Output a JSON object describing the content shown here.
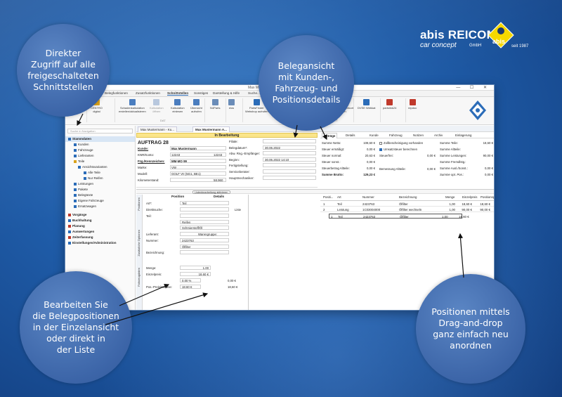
{
  "logo": {
    "brand": "abis REICOM",
    "tagline": "car concept",
    "gmbh": "GmbH",
    "since": "seit 1987",
    "abis": "abis"
  },
  "bubbles": {
    "b1": "Direkter\nZugriff auf alle\nfreigeschalteten\nSchnittstellen",
    "b2": "Belegansicht\nmit Kunden-,\nFahrzeug- und\nPositionsdetails",
    "b3": "Bearbeiten Sie\ndie Belegpositionen\nin der Einzelansicht\noder direkt in\nder Liste",
    "b4": "Positionen mittels\nDrag-and-drop\nganz einfach neu\nanordnen"
  },
  "window": {
    "title": "Max Mustermann - ...",
    "controls": "— ☐ ✕",
    "ribbon_tabs": [
      "Datei",
      "Belegfunktionen",
      "Zusatzfunktionen",
      "Schnittstellen",
      "Sonstiges",
      "Darstellung & Hilfe",
      "Suche..."
    ]
  },
  "ribbon": {
    "buttons": [
      {
        "label": "ATP Pilot",
        "color": "#2b6cb8"
      },
      {
        "label": "CENTRO\ndigital",
        "color": "#d9a21b"
      },
      {
        "label": "Schadenkalkulation\nerstellen/aktualisieren",
        "color": "#4a7dbf"
      },
      {
        "label": "Kalkulation\nöffnen",
        "color": "#b8c8de"
      },
      {
        "label": "Kalkulation\neinlesen",
        "color": "#4a7dbf"
      },
      {
        "label": "Übersicht\naufrufen",
        "color": "#4a7dbf"
      },
      {
        "label": "N4Parts",
        "color": "#6a8cb8"
      },
      {
        "label": "eios",
        "color": "#6a8cb8"
      },
      {
        "label": "PartsFinder\nWebshop aufrufen",
        "color": "#2b6cb8"
      },
      {
        "label": "PartsFinder Warenkorb\nimportieren",
        "color": "#2b6cb8"
      },
      {
        "label": "DVSE NEXT\naufrufen",
        "color": "#b8c8de"
      },
      {
        "label": "DVSE NEXT Warenkorb\nimportieren",
        "color": "#2b6cb8"
      },
      {
        "label": "DVSE Webkat",
        "color": "#2b6cb8"
      },
      {
        "label": "partslink24",
        "color": "#c0392b"
      },
      {
        "label": "repdoc",
        "color": "#c0392b"
      }
    ],
    "groups": [
      "DAT",
      "PartsFinder",
      "DVSE NEXT"
    ]
  },
  "sidebar": {
    "search_placeholder": "Suche in Navigation",
    "items": [
      {
        "label": "Stammdaten",
        "type": "h",
        "color": "#2b6cb8"
      },
      {
        "label": "Kunden",
        "type": "c",
        "color": "#2b6cb8"
      },
      {
        "label": "Fahrzeuge",
        "type": "c",
        "color": "#2b6cb8"
      },
      {
        "label": "Lieferanten",
        "type": "c",
        "color": "#2b6cb8"
      },
      {
        "label": "Teile",
        "type": "c",
        "color": "#d9a21b"
      },
      {
        "label": "Ansichtsvarianten",
        "type": "d",
        "color": "#2b6cb8"
      },
      {
        "label": "Alle Teile",
        "type": "e",
        "color": "#2b6cb8"
      },
      {
        "label": "Nur Reifen",
        "type": "e",
        "color": "#2b6cb8"
      },
      {
        "label": "Leistungen",
        "type": "c",
        "color": "#2b6cb8"
      },
      {
        "label": "Pakete",
        "type": "c",
        "color": "#2b6cb8"
      },
      {
        "label": "Belegtexte",
        "type": "c",
        "color": "#2b6cb8"
      },
      {
        "label": "Eigene Fahrzeuge",
        "type": "c",
        "color": "#2b6cb8"
      },
      {
        "label": "Ersatzwagen",
        "type": "c",
        "color": "#2b6cb8"
      },
      {
        "label": "Vorgänge",
        "type": "h",
        "color": "#c0392b"
      },
      {
        "label": "Buchhaltung",
        "type": "h",
        "color": "#2b6cb8"
      },
      {
        "label": "Planung",
        "type": "h",
        "color": "#c0392b"
      },
      {
        "label": "Auswertungen",
        "type": "h",
        "color": "#2b6cb8"
      },
      {
        "label": "Zeiterfassung",
        "type": "h",
        "color": "#c0392b"
      },
      {
        "label": "Einstellungen/Administration",
        "type": "h",
        "color": "#2b6cb8"
      }
    ]
  },
  "doc_tabs": [
    "Max Mustermann - Ku...",
    "Max Mustermann A..."
  ],
  "status": "In Bearbeitung",
  "form": {
    "title": "AUFTRAG 28",
    "left": [
      {
        "label": "Kunde:",
        "value": "Max Mustermann",
        "extra": ""
      },
      {
        "label": "KNR/Konto:",
        "value": "12243",
        "extra": "12243"
      },
      {
        "label": "Fzg./Kennzeichen:",
        "value": "MM-MO 99",
        "extra": ""
      },
      {
        "label": "Marke:",
        "value": "VW",
        "extra": ""
      },
      {
        "label": "Modell:",
        "value": "GOLF VII (5G1, BE1)",
        "extra": ""
      },
      {
        "label": "Kilometerstand:",
        "value": "",
        "extra": "58.960"
      }
    ],
    "right": [
      {
        "label": "Filiale:",
        "value": ""
      },
      {
        "label": "Belegdatum*:",
        "value": "30.06.2022"
      },
      {
        "label": "Abw. Rng.-Empfänger:",
        "value": ""
      },
      {
        "label": "Beginn:",
        "value": "30.06.2022 14:10"
      },
      {
        "label": "Fertigstellung:",
        "value": ""
      },
      {
        "label": "Serviceberater:",
        "value": ""
      },
      {
        "label": "Hauptmechaniker:",
        "value": ""
      }
    ]
  },
  "summary": {
    "tabs": [
      "Beträge",
      "Details",
      "Kunde",
      "Fahrzeug",
      "Notizen",
      "Archiv",
      "Einlagerung"
    ],
    "col1": [
      {
        "label": "Summe Netto:",
        "value": "108,60 €"
      },
      {
        "label": "Steuer ermäßigt:",
        "value": "0,00 €"
      },
      {
        "label": "Steuer normal:",
        "value": "20,63 €"
      },
      {
        "label": "Steuer sonst.:",
        "value": "0,00 €"
      },
      {
        "label": "Steuerbetrag Altteile:",
        "value": "0,00 €"
      },
      {
        "label": "Summe Brutto:",
        "value": "129,23 €"
      }
    ],
    "col2": [
      {
        "label": "Zollbescheinigung vorhanden",
        "value": "",
        "check": false
      },
      {
        "label": "Umsatzsteuer berechnen",
        "value": "",
        "check": true
      },
      {
        "label": "Steuerfrei:",
        "value": "0,00 €",
        "check": null
      },
      {
        "label": "Bemessung Altteile:",
        "value": "0,00 €",
        "check": null
      }
    ],
    "col3": [
      {
        "label": "Summe Teile:",
        "value": "18,60 €"
      },
      {
        "label": "Summe Altteile:",
        "value": ""
      },
      {
        "label": "Summe Leistungen:",
        "value": "90,00 €"
      },
      {
        "label": "Summe Fremdlstg.:",
        "value": ""
      },
      {
        "label": "Summe Ausl./Sonst.:",
        "value": "0,00 €"
      },
      {
        "label": "Summe opt. Pos.:",
        "value": "0,00 €"
      }
    ]
  },
  "toolbar": {
    "pill": "Listenbearbeitung aktivieren"
  },
  "vtabs": [
    "Positionen",
    "Zusätzliche Optionen",
    "Fahrzeugdaten"
  ],
  "detail": {
    "headers": [
      "Position",
      "Details"
    ],
    "rows": [
      {
        "label": "Art*:",
        "value": "Teil"
      },
      {
        "label": "Direktsuche:",
        "value": ""
      },
      {
        "label": "Teil:",
        "value": ""
      },
      {
        "label": "",
        "value": "Reifen"
      },
      {
        "label": "",
        "value": "Schmierstoff/Öl"
      },
      {
        "label": "Lieferant:",
        "value": ""
      },
      {
        "label": "Nummer:",
        "value": "2423763"
      },
      {
        "label": "",
        "value": "Ölfilter"
      },
      {
        "label": "Bezeichnung:",
        "value": ""
      },
      {
        "label": "Menge:",
        "value": "1,00"
      },
      {
        "label": "Einzelpreis:",
        "value": "18,60 €"
      },
      {
        "label": "",
        "value": "0,00 %"
      },
      {
        "label": "Pos.-Preis/Summe:",
        "value": "18,60 €"
      }
    ],
    "warengruppe": "Warengruppe:",
    "liste": "Liste",
    "rabatt2": "0,00 €",
    "summe2": "18,60 €"
  },
  "grid": {
    "headers": [
      "Positi...",
      "Art",
      "Nummer",
      "Bezeichnung",
      "Menge",
      "Einzelpreis",
      "Positionspreis",
      "Positionssumme"
    ],
    "rows": [
      [
        "1",
        "Teil",
        "2423763",
        "Ölfilter",
        "1,00",
        "18,60 €",
        "18,60 €",
        "18,60 €"
      ],
      [
        "2",
        "Leistung",
        "1C03004000",
        "Ölfilter wechseln",
        "1,00",
        "90,00 €",
        "90,00 €",
        "90,00 €"
      ]
    ],
    "drag_row": [
      "1",
      "Teil",
      "2423763",
      "Ölfilter",
      "1,00",
      "18,60 €",
      "18,60 €"
    ]
  }
}
